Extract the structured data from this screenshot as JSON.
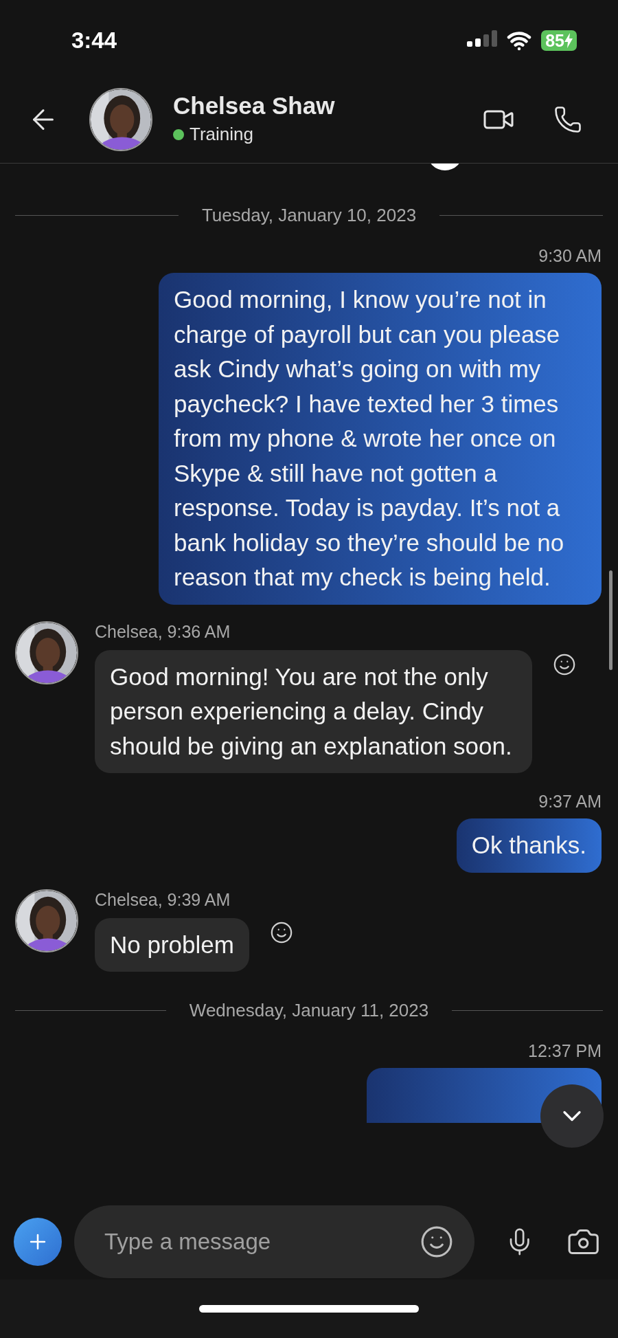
{
  "status_bar": {
    "time": "3:44",
    "battery": "85"
  },
  "header": {
    "name": "Chelsea Shaw",
    "status": "Training"
  },
  "messages": [
    {
      "kind": "date",
      "text": "Tuesday, January 10, 2023"
    },
    {
      "kind": "sent",
      "time": "9:30 AM",
      "text": "Good morning, I know you’re not in charge of payroll but can you please ask Cindy what’s going on with my paycheck? I have texted her 3 times from my phone & wrote her once on Skype & still have not gotten a response. Today is payday. It’s not a bank holiday so they’re should be no reason that my check is being held."
    },
    {
      "kind": "received",
      "meta": "Chelsea, 9:36 AM",
      "text": "Good morning! You are not the only person experiencing a delay. Cindy should be giving an explanation soon."
    },
    {
      "kind": "sent",
      "time": "9:37 AM",
      "text": "Ok thanks."
    },
    {
      "kind": "received",
      "meta": "Chelsea, 9:39 AM",
      "text": "No problem"
    },
    {
      "kind": "date",
      "text": "Wednesday, January 11, 2023"
    },
    {
      "kind": "sent",
      "time": "12:37 PM"
    }
  ],
  "composer": {
    "placeholder": "Type a message"
  }
}
